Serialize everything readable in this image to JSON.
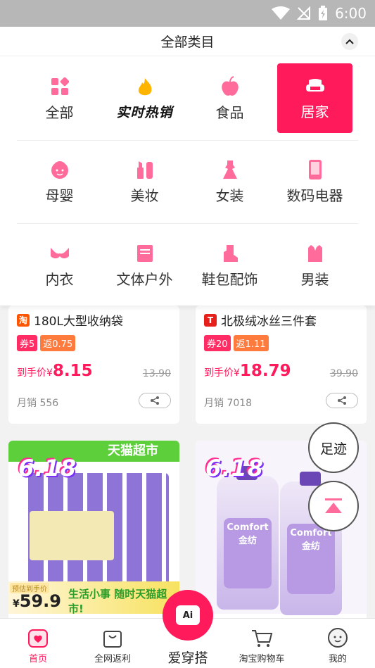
{
  "status_bar": {
    "time": "6:00"
  },
  "category_panel": {
    "title": "全部类目",
    "rows": [
      [
        {
          "label": "全部",
          "icon": "grid-icon"
        },
        {
          "label": "实时热销",
          "icon": "flame-icon"
        },
        {
          "label": "食品",
          "icon": "apple-icon"
        },
        {
          "label": "居家",
          "icon": "sofa-icon",
          "active": true
        }
      ],
      [
        {
          "label": "母婴",
          "icon": "baby-icon"
        },
        {
          "label": "美妆",
          "icon": "cosmetics-icon"
        },
        {
          "label": "女装",
          "icon": "dress-icon"
        },
        {
          "label": "数码电器",
          "icon": "phone-icon"
        }
      ],
      [
        {
          "label": "内衣",
          "icon": "bra-icon"
        },
        {
          "label": "文体户外",
          "icon": "book-icon"
        },
        {
          "label": "鞋包配饰",
          "icon": "boot-icon"
        },
        {
          "label": "男装",
          "icon": "shirt-icon"
        }
      ]
    ]
  },
  "products": [
    {
      "shop": "淘",
      "title": "180L大型收纳袋",
      "coupon": "券5",
      "rebate": "返0.75",
      "price_label": "到手价¥",
      "price": "8.15",
      "original": "13.90",
      "sales": "月销 556"
    },
    {
      "shop": "T",
      "title": "北极绒冰丝三件套",
      "coupon": "券20",
      "rebate": "返1.11",
      "price_label": "到手价¥",
      "price": "18.79",
      "original": "39.90",
      "sales": "月销 7018"
    }
  ],
  "promo_cards": [
    {
      "banner": "天猫超市",
      "badge": "6.18",
      "presale": "预估到手价",
      "price_symbol": "¥",
      "price": "59.9",
      "slogan": "生活小事 随时天猫超市!"
    },
    {
      "badge": "6.18",
      "brand": "Comfort 金纺"
    }
  ],
  "float_buttons": {
    "track": "足迹"
  },
  "tabbar": {
    "home": "首页",
    "rebate": "全网返利",
    "center_icon": "Ai",
    "center": "爱穿搭",
    "cart": "淘宝购物车",
    "mine": "我的"
  },
  "colors": {
    "accent": "#ff1a5c",
    "icon_pink": "#ff6b9a",
    "coupon": "#ff2d63",
    "rebate": "#ff7a3d"
  }
}
